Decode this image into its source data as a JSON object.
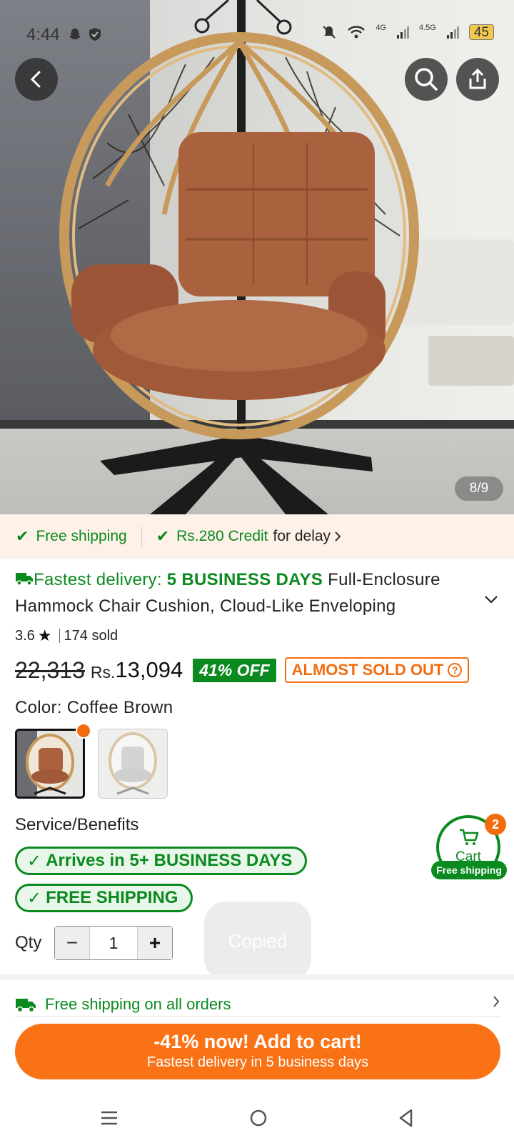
{
  "status_bar": {
    "time": "4:44",
    "network1": "4G",
    "network2": "4.5G",
    "battery": "45"
  },
  "gallery": {
    "counter": "8/9"
  },
  "shipping_strip": {
    "free_shipping": "Free shipping",
    "credit_amount": "Rs.280 Credit",
    "credit_suffix": "for delay"
  },
  "product": {
    "delivery_prefix": "Fastest delivery: ",
    "delivery_bold": "5 BUSINESS DAYS",
    "title": " Full-Enclosure Hammock Chair Cushion, Cloud-Like Enveloping",
    "rating": "3.6",
    "sold": "174 sold",
    "original_price": "22,313",
    "currency": "Rs.",
    "price": "13,094",
    "discount": "41% OFF",
    "stock_badge": "ALMOST SOLD OUT",
    "color_label": "Color: Coffee Brown",
    "colors": [
      {
        "name": "Coffee Brown",
        "selected": true
      },
      {
        "name": "Light Gray",
        "selected": false
      }
    ]
  },
  "services": {
    "label": "Service/Benefits",
    "badges": [
      "Arrives in 5+ BUSINESS DAYS",
      "FREE SHIPPING"
    ]
  },
  "quantity": {
    "label": "Qty",
    "value": "1",
    "minus": "−",
    "plus": "+"
  },
  "toast": "Copied",
  "cart": {
    "label": "Cart",
    "count": "2",
    "free_shipping": "Free shipping"
  },
  "promo": {
    "text": "Free shipping on all orders"
  },
  "cta": {
    "line1": "-41% now! Add to cart!",
    "line2": "Fastest delivery in 5 business days"
  },
  "colors": {
    "green": "#0a8a1f",
    "orange": "#f26c0d",
    "cta": "#f97316"
  }
}
